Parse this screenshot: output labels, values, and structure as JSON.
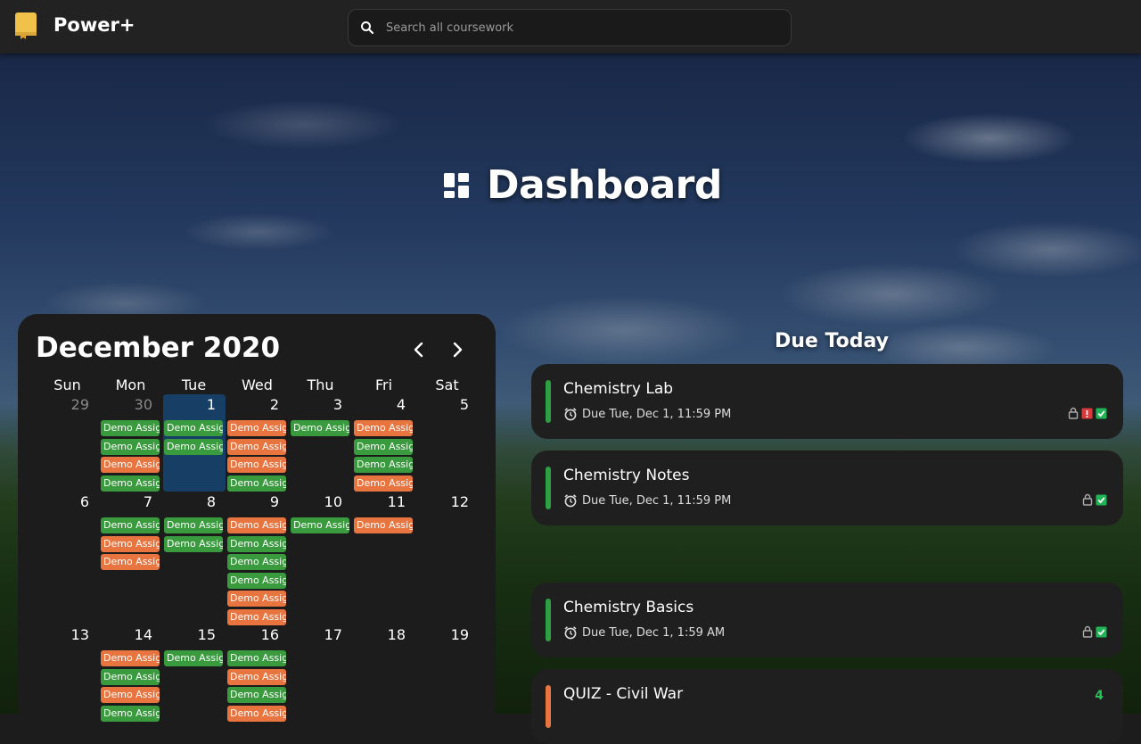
{
  "app": {
    "name": "Power+"
  },
  "search": {
    "placeholder": "Search all coursework"
  },
  "page": {
    "title": "Dashboard"
  },
  "calendar": {
    "month_label": "December 2020",
    "weekdays": [
      "Sun",
      "Mon",
      "Tue",
      "Wed",
      "Thu",
      "Fri",
      "Sat"
    ],
    "weeks": [
      [
        {
          "day": "29",
          "muted": true,
          "events": []
        },
        {
          "day": "30",
          "muted": true,
          "events": [
            "green",
            "green",
            "orange",
            "green"
          ]
        },
        {
          "day": "1",
          "today": true,
          "events": [
            "green",
            "green"
          ]
        },
        {
          "day": "2",
          "events": [
            "orange",
            "orange",
            "orange",
            "green"
          ]
        },
        {
          "day": "3",
          "events": [
            "green"
          ]
        },
        {
          "day": "4",
          "events": [
            "orange",
            "green",
            "green",
            "orange"
          ]
        },
        {
          "day": "5",
          "events": []
        }
      ],
      [
        {
          "day": "6",
          "events": []
        },
        {
          "day": "7",
          "events": [
            "green",
            "orange",
            "orange"
          ]
        },
        {
          "day": "8",
          "events": [
            "green",
            "green"
          ]
        },
        {
          "day": "9",
          "events": [
            "orange",
            "green",
            "green",
            "green",
            "orange",
            "orange"
          ]
        },
        {
          "day": "10",
          "events": [
            "green"
          ]
        },
        {
          "day": "11",
          "events": [
            "orange"
          ]
        },
        {
          "day": "12",
          "events": []
        }
      ],
      [
        {
          "day": "13",
          "events": []
        },
        {
          "day": "14",
          "events": [
            "orange",
            "green",
            "orange",
            "green"
          ]
        },
        {
          "day": "15",
          "events": [
            "green"
          ]
        },
        {
          "day": "16",
          "events": [
            "green",
            "orange",
            "green",
            "orange"
          ]
        },
        {
          "day": "17",
          "events": []
        },
        {
          "day": "18",
          "events": []
        },
        {
          "day": "19",
          "events": []
        }
      ]
    ],
    "event_label": "Demo Assignment",
    "colors": {
      "green": "#3a9a3e",
      "orange": "#e8753f",
      "today": "#173f66"
    }
  },
  "due_today": {
    "title": "Due Today",
    "items": [
      {
        "name": "Chemistry Lab",
        "due": "Due Tue, Dec 1, 11:59 PM",
        "color": "#2ea043",
        "icons": [
          "lock-icon",
          "alert-clipboard-icon",
          "check-clipboard-icon"
        ]
      },
      {
        "name": "Chemistry Notes",
        "due": "Due Tue, Dec 1, 11:59 PM",
        "color": "#2ea043",
        "icons": [
          "lock-icon",
          "check-clipboard-icon"
        ]
      },
      {
        "name": "Chemistry Basics",
        "due": "Due Tue, Dec 1, 1:59 AM",
        "color": "#2ea043",
        "icons": [
          "lock-icon",
          "check-clipboard-icon"
        ]
      },
      {
        "name": "QUIZ - Civil War",
        "due": "",
        "color": "#e8753f",
        "count": "4",
        "icons": []
      }
    ]
  }
}
